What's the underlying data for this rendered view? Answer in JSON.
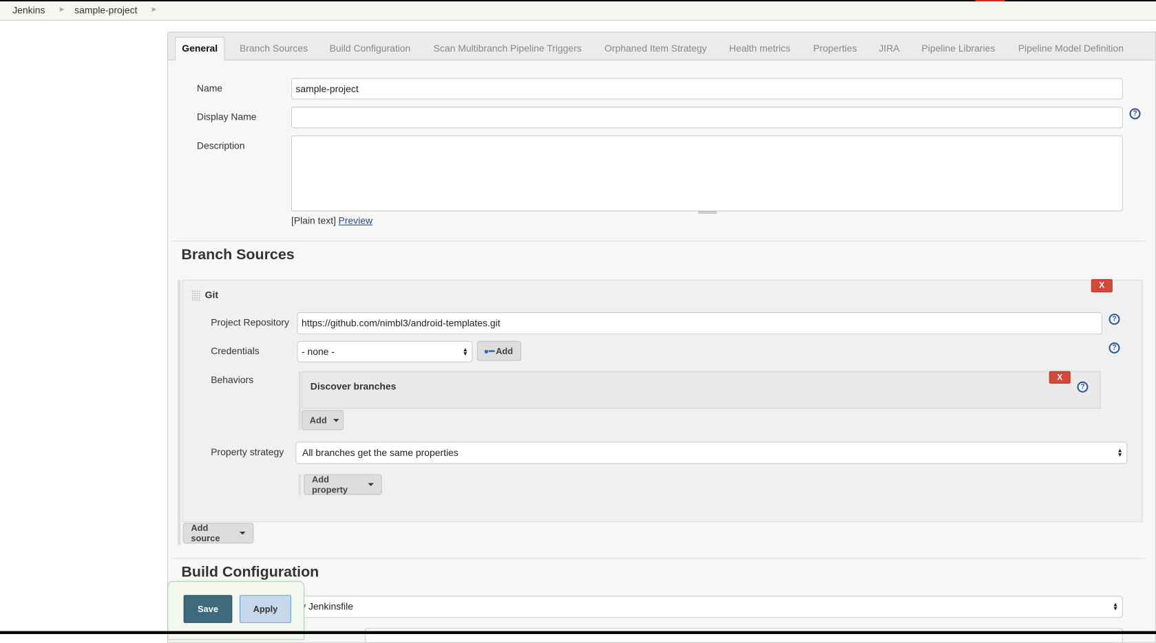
{
  "breadcrumbs": [
    "Jenkins",
    "sample-project"
  ],
  "tabs": [
    "General",
    "Branch Sources",
    "Build Configuration",
    "Scan Multibranch Pipeline Triggers",
    "Orphaned Item Strategy",
    "Health metrics",
    "Properties",
    "JIRA",
    "Pipeline Libraries",
    "Pipeline Model Definition"
  ],
  "general": {
    "name_label": "Name",
    "name_value": "sample-project",
    "display_name_label": "Display Name",
    "display_name_value": "",
    "description_label": "Description",
    "description_value": "",
    "plain_text": "[Plain text]",
    "preview": "Preview"
  },
  "branch_sources": {
    "heading": "Branch Sources",
    "git": {
      "title": "Git",
      "delete": "X",
      "repo_label": "Project Repository",
      "repo_value": "https://github.com/nimbl3/android-templates.git",
      "credentials_label": "Credentials",
      "credentials_value": "- none -",
      "add_credentials": "Add",
      "behaviors_label": "Behaviors",
      "behavior": "Discover branches",
      "behavior_delete": "X",
      "add_behavior": "Add",
      "property_strategy_label": "Property strategy",
      "property_strategy_value": "All branches get the same properties",
      "add_property": "Add property"
    },
    "add_source": "Add source"
  },
  "build_configuration": {
    "heading": "Build Configuration",
    "mode_value": "by Jenkinsfile"
  },
  "footer": {
    "save": "Save",
    "apply": "Apply"
  },
  "help_icon": "?",
  "colors": {
    "save": "#3d6a7d",
    "apply": "#c5d8ec",
    "delete": "#d24939",
    "help": "#2f5b9b"
  }
}
